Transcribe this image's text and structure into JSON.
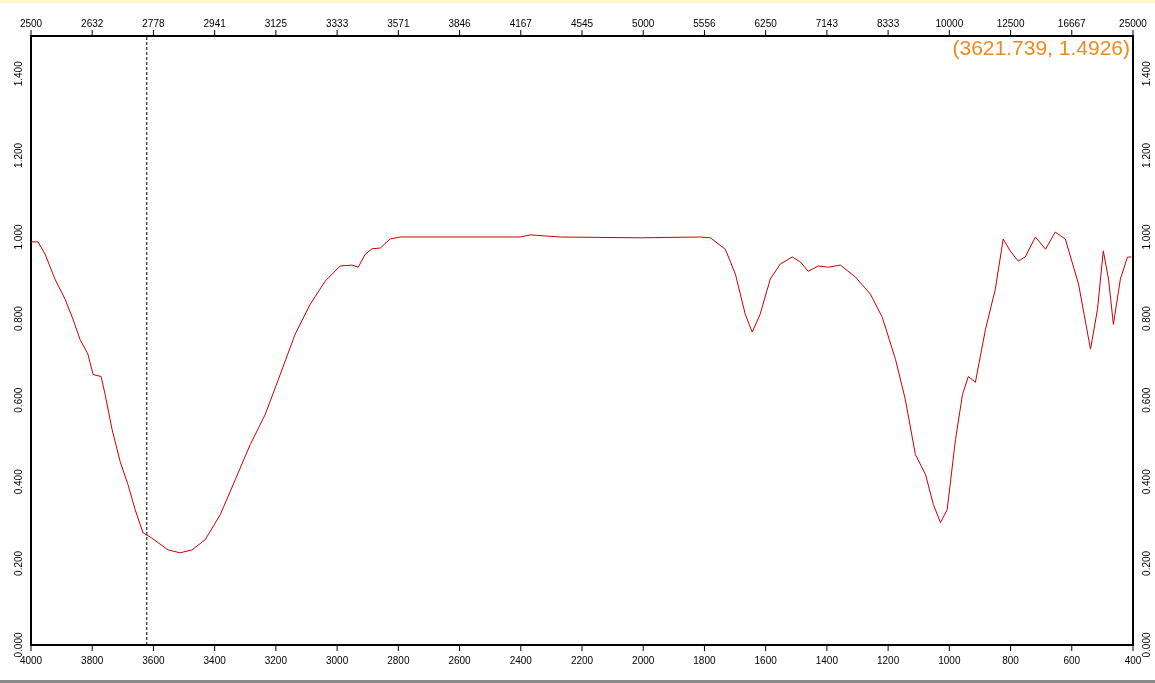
{
  "chart_data": {
    "type": "line",
    "xlim": [
      4000,
      400
    ],
    "ylim": [
      0,
      1.4926
    ],
    "xticks": [
      4000,
      3800,
      3600,
      3400,
      3200,
      3000,
      2800,
      2600,
      2400,
      2200,
      2000,
      1800,
      1600,
      1400,
      1200,
      1000,
      800,
      600,
      400
    ],
    "yticks": [
      {
        "value": 0,
        "label": "0.000"
      },
      {
        "value": 0.2,
        "label": "0.200"
      },
      {
        "value": 0.4,
        "label": "0.400"
      },
      {
        "value": 0.6,
        "label": "0.600"
      },
      {
        "value": 0.8,
        "label": "0.800"
      },
      {
        "value": 1.0,
        "label": "1.000"
      },
      {
        "value": 1.2,
        "label": "1.200"
      },
      {
        "value": 1.4,
        "label": "1.400"
      }
    ],
    "series": [
      {
        "color": "#cc0000",
        "x": [
          4000,
          3977,
          3954,
          3922,
          3889,
          3863,
          3840,
          3814,
          3797,
          3771,
          3758,
          3735,
          3709,
          3683,
          3660,
          3634,
          3611,
          3585,
          3552,
          3513,
          3474,
          3431,
          3382,
          3333,
          3284,
          3235,
          3186,
          3137,
          3088,
          3039,
          2990,
          2951,
          2931,
          2908,
          2886,
          2859,
          2827,
          2794,
          2631,
          2402,
          2369,
          2271,
          2010,
          1814,
          1781,
          1732,
          1699,
          1667,
          1644,
          1618,
          1585,
          1552,
          1513,
          1487,
          1461,
          1428,
          1395,
          1356,
          1307,
          1258,
          1219,
          1176,
          1144,
          1111,
          1078,
          1052,
          1029,
          1007,
          980,
          957,
          938,
          915,
          882,
          850,
          824,
          801,
          775,
          752,
          719,
          686,
          654,
          621,
          578,
          539,
          516,
          497,
          480,
          464,
          441,
          418,
          405
        ],
        "values": [
          0.988,
          0.988,
          0.958,
          0.897,
          0.848,
          0.799,
          0.749,
          0.713,
          0.663,
          0.658,
          0.614,
          0.528,
          0.45,
          0.393,
          0.332,
          0.275,
          0.265,
          0.251,
          0.233,
          0.226,
          0.233,
          0.258,
          0.319,
          0.405,
          0.491,
          0.565,
          0.663,
          0.762,
          0.835,
          0.892,
          0.929,
          0.931,
          0.926,
          0.958,
          0.971,
          0.973,
          0.995,
          1.0,
          1.0,
          1.0,
          1.005,
          1.0,
          0.998,
          1.0,
          0.998,
          0.97,
          0.909,
          0.811,
          0.767,
          0.811,
          0.897,
          0.934,
          0.951,
          0.939,
          0.916,
          0.929,
          0.926,
          0.931,
          0.902,
          0.86,
          0.803,
          0.7,
          0.602,
          0.467,
          0.418,
          0.344,
          0.3,
          0.332,
          0.504,
          0.614,
          0.658,
          0.644,
          0.774,
          0.872,
          0.995,
          0.966,
          0.941,
          0.951,
          1.0,
          0.97,
          1.012,
          0.995,
          0.885,
          0.725,
          0.823,
          0.966,
          0.897,
          0.786,
          0.897,
          0.951,
          0.951
        ]
      }
    ],
    "ref_lines": [
      {
        "axis": "x",
        "value": 3621.739
      },
      {
        "axis": "y",
        "value": 1.4926
      }
    ],
    "annotations": [
      "(3621.739, 1.4926)"
    ]
  },
  "top_axis_labels": [
    "2500",
    "2632",
    "2778",
    "2941",
    "3125",
    "3333",
    "3571",
    "3846",
    "4167",
    "4545",
    "5000",
    "5556",
    "6250",
    "7143",
    "8333",
    "10000",
    "12500",
    "16667",
    "25000"
  ],
  "right_axis_labels": [
    "0.000",
    "0.200",
    "0.400",
    "0.600",
    "0.800",
    "1.000",
    "1.200",
    "1.400"
  ]
}
